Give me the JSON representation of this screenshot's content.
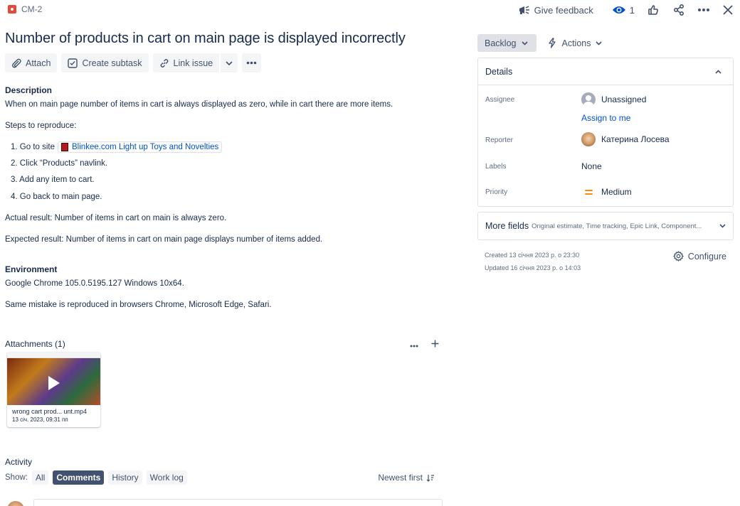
{
  "issue": {
    "key": "CM-2",
    "title": "Number of products in cart on main page is displayed incorrectly"
  },
  "top_actions": {
    "feedback_label": "Give feedback",
    "watch_count": "1"
  },
  "toolbar": {
    "attach": "Attach",
    "create_subtask": "Create subtask",
    "link_issue": "Link issue"
  },
  "description": {
    "heading": "Description",
    "intro": "When on main page number of items in cart is always displayed as zero, while in cart there are more items.",
    "steps_heading": "Steps to reproduce:",
    "step1_prefix": "1. Go to site",
    "step1_link": "Blinkee.com Light up Toys and Novelties",
    "step2": "2. Click “Products” navlink.",
    "step3": "3. Add any item to cart.",
    "step4": "4. Go back to main page.",
    "actual": "Actual result: Number of items in cart on main is always zero.",
    "expected": "Expected result: Number of items in cart on main page displays number of items added."
  },
  "environment": {
    "heading": "Environment",
    "line1": "Google Chrome 105.0.5195.127 Windows 10x64.",
    "line2": "Same mistake is reproduced in browsers Chrome, Microsoft Edge, Safari."
  },
  "attachments": {
    "heading": "Attachments (1)",
    "file_name": "wrong cart prod... unt.mp4",
    "file_date": "13 січ. 2023, 09:31 пп"
  },
  "activity": {
    "heading": "Activity",
    "show_label": "Show:",
    "filters": [
      "All",
      "Comments",
      "History",
      "Work log"
    ],
    "active_filter": "Comments",
    "sort_label": "Newest first"
  },
  "sidebar": {
    "status": "Backlog",
    "actions": "Actions",
    "details_title": "Details",
    "assignee_label": "Assignee",
    "assignee_value": "Unassigned",
    "assign_to_me": "Assign to me",
    "reporter_label": "Reporter",
    "reporter_value": "Катерина Лосева",
    "labels_label": "Labels",
    "labels_value": "None",
    "priority_label": "Priority",
    "priority_value": "Medium",
    "more_fields_title": "More fields",
    "more_fields_sub": "Original estimate, Time tracking, Epic Link, Component...",
    "created": "Created 13 січня 2023 р. о 23:30",
    "updated": "Updated 16 січня 2023 р. о 14:03",
    "configure": "Configure"
  },
  "colors": {
    "link": "#0052cc",
    "text": "#172b4d",
    "subtle": "#5e6c84",
    "bug": "#e5493a",
    "priority_medium": "#ff8b00",
    "active_chip": "#42526e"
  }
}
